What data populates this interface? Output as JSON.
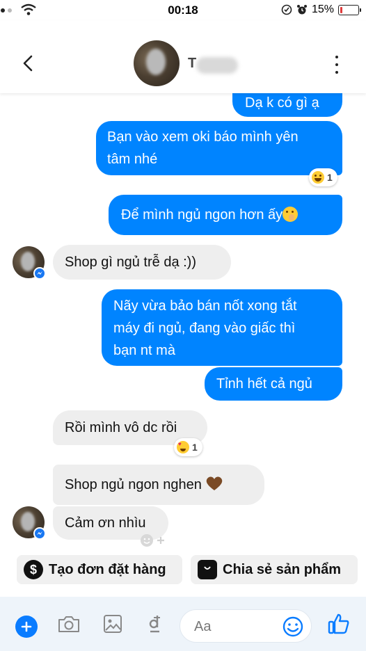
{
  "status_bar": {
    "time": "00:18",
    "battery_text": "15%",
    "battery_level": 0.15,
    "battery_color": "#e03b3b"
  },
  "header": {
    "contact_initial": "T"
  },
  "messages": [
    {
      "direction": "out",
      "text": "Dạ k có gì ạ"
    },
    {
      "direction": "out",
      "lines": [
        "Bạn vào xem oki báo mình yên",
        "tâm nhé"
      ],
      "reaction": {
        "emoji": "grinning-face",
        "count": "1"
      }
    },
    {
      "direction": "out",
      "text": "Để mình ngủ ngon hơn ấy",
      "trailing_emoji": "shushing-face"
    },
    {
      "direction": "in",
      "text": "Shop gì ngủ trễ dạ :))"
    },
    {
      "direction": "out",
      "lines": [
        "Nãy vừa bảo bán nốt xong tắt",
        "máy đi ngủ, đang vào giấc thì",
        "bạn nt mà"
      ]
    },
    {
      "direction": "out",
      "text": "Tỉnh hết cả ngủ"
    },
    {
      "direction": "in",
      "text": "Rồi mình vô dc rồi",
      "reaction": {
        "emoji": "heart-eyes-face",
        "count": "1"
      }
    },
    {
      "direction": "in",
      "text": "Shop ngủ ngon nghen",
      "trailing_emoji": "brown-heart"
    },
    {
      "direction": "in",
      "text": "Cảm ơn nhìu"
    }
  ],
  "quick_actions": [
    {
      "label": "Tạo đơn đặt hàng",
      "icon": "dollar-icon"
    },
    {
      "label": "Chia sẻ sản phẩm",
      "icon": "shopping-bag-icon"
    }
  ],
  "composer": {
    "placeholder": "Aa",
    "accent": "#0a7cff"
  },
  "colors": {
    "outgoing_bubble": "#0084ff",
    "incoming_bubble": "#eeeeee",
    "brown_heart": "#7a4a25"
  }
}
